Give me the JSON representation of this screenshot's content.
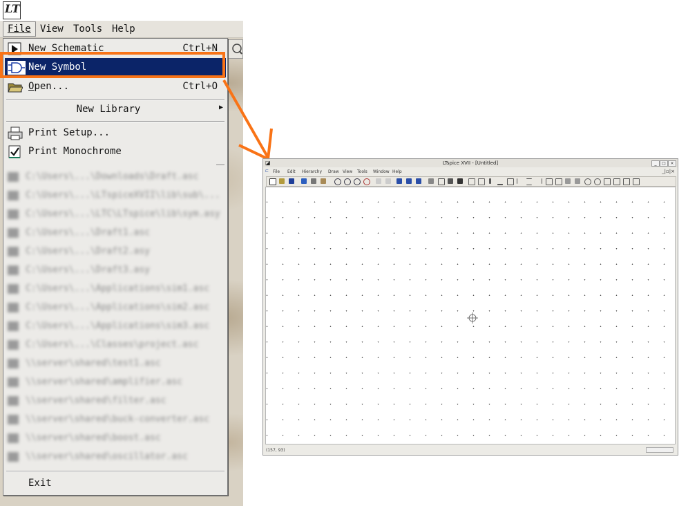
{
  "left_window": {
    "logo_text": "LT",
    "menubar": [
      {
        "label": "File",
        "mnemonic_index": 0,
        "active": true
      },
      {
        "label": "View",
        "mnemonic_index": 0,
        "active": false
      },
      {
        "label": "Tools",
        "mnemonic_index": 0,
        "active": false
      },
      {
        "label": "Help",
        "mnemonic_index": 0,
        "active": false
      }
    ],
    "file_menu": {
      "new_schematic": {
        "label": "New Schematic",
        "accel": "Ctrl+N",
        "icon": "new-schematic-icon"
      },
      "new_symbol": {
        "label": "New Symbol",
        "accel": "",
        "icon": "symbol-icon",
        "highlighted": true
      },
      "open": {
        "label": "Open...",
        "accel": "Ctrl+O",
        "icon": "folder-open-icon"
      },
      "new_library": {
        "label": "New Library",
        "has_submenu": true
      },
      "print_setup": {
        "label": "Print Setup...",
        "icon": "printer-icon"
      },
      "print_monochrome": {
        "label": "Print Monochrome",
        "checked": true
      },
      "recent_files": [
        "C:\\Users\\...\\Downloads\\Draft.asc",
        "C:\\Users\\...\\LTspiceXVII\\lib\\sub\\...",
        "C:\\Users\\...\\LTC\\LTspice\\lib\\sym.asy",
        "C:\\Users\\...\\Draft1.asc",
        "C:\\Users\\...\\Draft2.asy",
        "C:\\Users\\...\\Draft3.asy",
        "C:\\Users\\...\\Applications\\sim1.asc",
        "C:\\Users\\...\\Applications\\sim2.asc",
        "C:\\Users\\...\\Applications\\sim3.asc",
        "C:\\Users\\...\\Classes\\project.asc",
        "\\\\server\\shared\\test1.asc",
        "\\\\server\\shared\\amplifier.asc",
        "\\\\server\\shared\\filter.asc",
        "\\\\server\\shared\\buck-converter.asc",
        "\\\\server\\shared\\boost.asc",
        "\\\\server\\shared\\oscillator.asc"
      ],
      "exit": {
        "label": "Exit"
      }
    }
  },
  "editor_window": {
    "title": "LTspice XVII - [Untitled]",
    "menubar": [
      "File",
      "Edit",
      "Hierarchy",
      "Draw",
      "View",
      "Tools",
      "Window",
      "Help"
    ],
    "status_coords": "(157, 93)"
  },
  "colors": {
    "highlight_box": "#f97316",
    "menu_selection": "#0b2468",
    "arrow": "#f97316"
  }
}
